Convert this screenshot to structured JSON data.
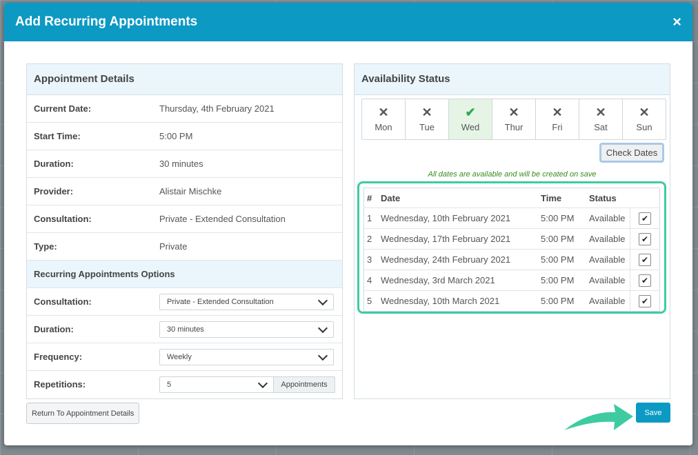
{
  "modal": {
    "title": "Add Recurring Appointments",
    "close_glyph": "×"
  },
  "details": {
    "heading": "Appointment Details",
    "rows": [
      {
        "label": "Current Date:",
        "value": "Thursday, 4th February 2021"
      },
      {
        "label": "Start Time:",
        "value": "5:00 PM"
      },
      {
        "label": "Duration:",
        "value": "30 minutes"
      },
      {
        "label": "Provider:",
        "value": "Alistair Mischke"
      },
      {
        "label": "Consultation:",
        "value": "Private - Extended Consultation"
      },
      {
        "label": "Type:",
        "value": "Private"
      }
    ]
  },
  "options": {
    "heading": "Recurring Appointments Options",
    "consultation": {
      "label": "Consultation:",
      "value": "Private - Extended Consultation"
    },
    "duration": {
      "label": "Duration:",
      "value": "30 minutes"
    },
    "frequency": {
      "label": "Frequency:",
      "value": "Weekly"
    },
    "repetitions": {
      "label": "Repetitions:",
      "value": "5",
      "addon": "Appointments"
    }
  },
  "return_button": "Return To Appointment Details",
  "availability": {
    "heading": "Availability Status",
    "days": [
      {
        "label": "Mon",
        "mark": "✕",
        "selected": false
      },
      {
        "label": "Tue",
        "mark": "✕",
        "selected": false
      },
      {
        "label": "Wed",
        "mark": "✔",
        "selected": true
      },
      {
        "label": "Thur",
        "mark": "✕",
        "selected": false
      },
      {
        "label": "Fri",
        "mark": "✕",
        "selected": false
      },
      {
        "label": "Sat",
        "mark": "✕",
        "selected": false
      },
      {
        "label": "Sun",
        "mark": "✕",
        "selected": false
      }
    ],
    "check_button": "Check Dates",
    "message": "All dates are available and will be created on save",
    "table": {
      "headers": [
        "#",
        "Date",
        "Time",
        "Status"
      ],
      "rows": [
        {
          "n": "1",
          "date": "Wednesday, 10th February 2021",
          "time": "5:00 PM",
          "status": "Available",
          "checked": true
        },
        {
          "n": "2",
          "date": "Wednesday, 17th February 2021",
          "time": "5:00 PM",
          "status": "Available",
          "checked": true
        },
        {
          "n": "3",
          "date": "Wednesday, 24th February 2021",
          "time": "5:00 PM",
          "status": "Available",
          "checked": true
        },
        {
          "n": "4",
          "date": "Wednesday, 3rd March 2021",
          "time": "5:00 PM",
          "status": "Available",
          "checked": true
        },
        {
          "n": "5",
          "date": "Wednesday, 10th March 2021",
          "time": "5:00 PM",
          "status": "Available",
          "checked": true
        }
      ]
    }
  },
  "save_button": "Save",
  "colors": {
    "header": "#0c99c4",
    "highlight": "#3ecba1",
    "success": "#2fa84f"
  }
}
